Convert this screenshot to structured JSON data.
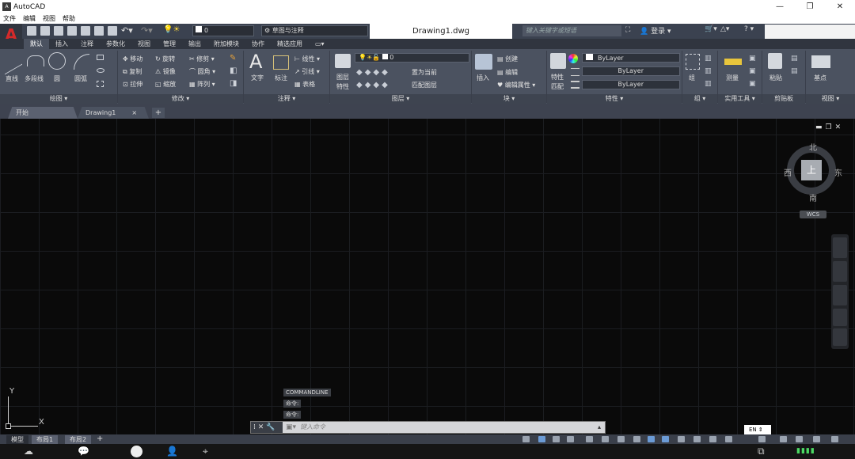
{
  "window": {
    "title": "AutoCAD",
    "file_title": "Drawing1.dwg",
    "minimize": "—",
    "maximize": "❐",
    "close": "✕"
  },
  "menu": [
    "文件",
    "编辑",
    "视图",
    "帮助"
  ],
  "qat": {
    "layer_value": "0",
    "workspace": "草图与注释",
    "search_placeholder": "键入关键字或短语",
    "signin": "登录",
    "help": "?"
  },
  "ribbon_tabs": [
    "默认",
    "插入",
    "注释",
    "参数化",
    "视图",
    "管理",
    "输出",
    "附加模块",
    "协作",
    "精选应用"
  ],
  "active_tab": "默认",
  "draw": {
    "line": "直线",
    "polyline": "多段线",
    "circle": "圆",
    "arc": "圆弧",
    "title": "绘图 ▾"
  },
  "modify": {
    "move": "移动",
    "rotate": "旋转",
    "trim": "修剪",
    "copy": "复制",
    "mirror": "镜像",
    "fillet": "圆角",
    "stretch": "拉伸",
    "scale": "缩放",
    "array": "阵列",
    "title": "修改 ▾"
  },
  "annotation": {
    "text": "文字",
    "dimension": "标注",
    "linear": "线性",
    "leader": "引线",
    "table": "表格",
    "title": "注释 ▾"
  },
  "layers": {
    "layer_props": "图层",
    "layer_props2": "特性",
    "current": "0",
    "make_current": "置为当前",
    "match_layer": "匹配图层",
    "title": "图层 ▾"
  },
  "block": {
    "insert": "插入",
    "create": "创建",
    "edit": "编辑",
    "edit_attr": "编辑属性",
    "title": "块 ▾"
  },
  "properties": {
    "match": "特性",
    "match2": "匹配",
    "color": "ByLayer",
    "linetype": "ByLayer",
    "lineweight": "ByLayer",
    "title": "特性 ▾"
  },
  "groups": {
    "group": "组",
    "title": "组 ▾"
  },
  "utilities": {
    "measure": "测量",
    "title": "实用工具 ▾"
  },
  "clipboard": {
    "paste": "粘贴",
    "title": "剪贴板"
  },
  "view_panel": {
    "base": "基点",
    "title": "视图 ▾"
  },
  "doc_tabs": {
    "start": "开始",
    "drawing": "Drawing1",
    "add": "+"
  },
  "viewcube": {
    "north": "北",
    "south": "南",
    "east": "东",
    "west": "西",
    "top": "上",
    "wcs": "WCS"
  },
  "ucs": {
    "x": "X",
    "y": "Y"
  },
  "command": {
    "history": [
      "COMMANDLINE",
      "命令:",
      "命令:"
    ],
    "placeholder": "键入命令"
  },
  "layout_tabs": [
    "模型",
    "布局1",
    "布局2"
  ],
  "status": {
    "lang": "EN"
  }
}
